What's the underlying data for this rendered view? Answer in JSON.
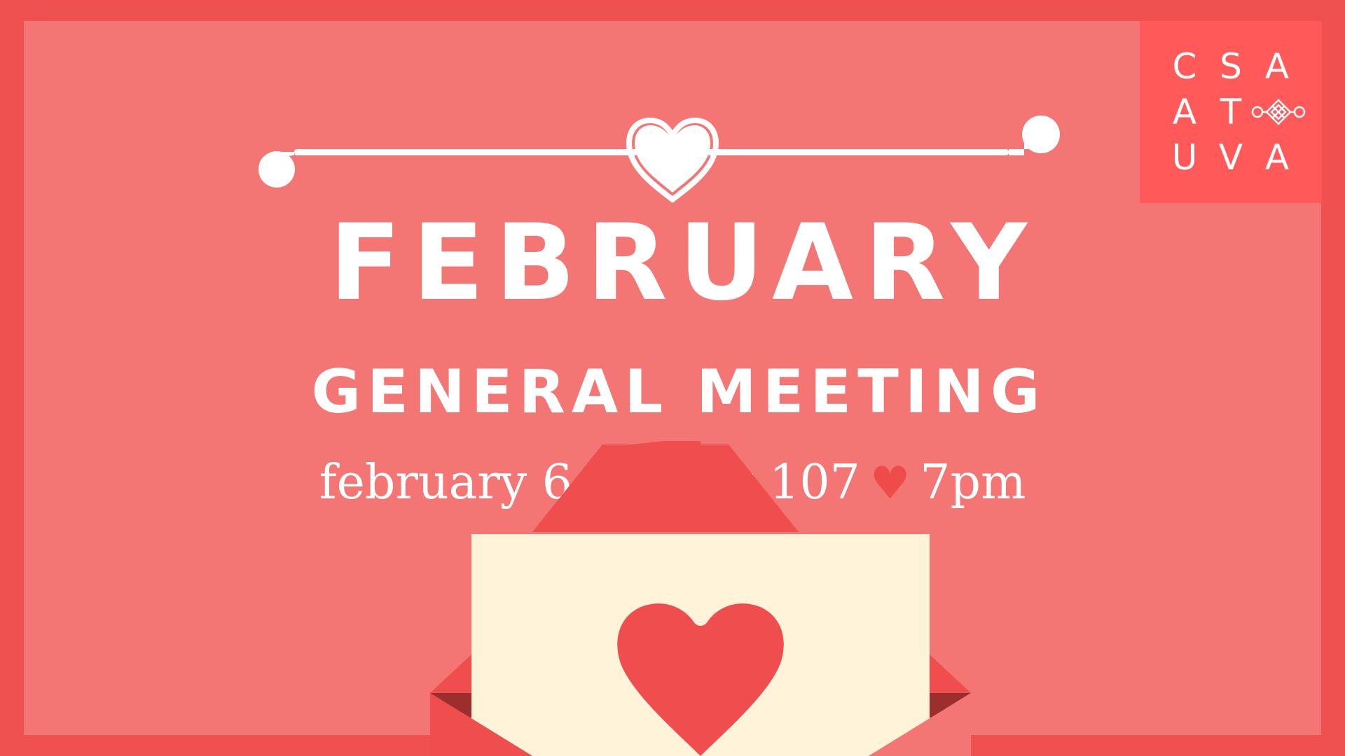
{
  "logo": {
    "letters": [
      "C",
      "S",
      "A",
      "A",
      "T",
      "U",
      "V",
      "A"
    ],
    "knot_icon": "chinese-knot-icon"
  },
  "title": {
    "main": "FEBRUARY",
    "sub": "GENERAL MEETING"
  },
  "details": {
    "date": "february 6",
    "location": "clark 107",
    "time": "7pm",
    "separator_icon": "heart-icon"
  },
  "colors": {
    "border": "#ef5050",
    "background": "#f37674",
    "logo_box": "#ff5a59",
    "text": "#ffffff",
    "accent_heart": "#ef4b4b",
    "letter_paper": "#fff3da"
  }
}
